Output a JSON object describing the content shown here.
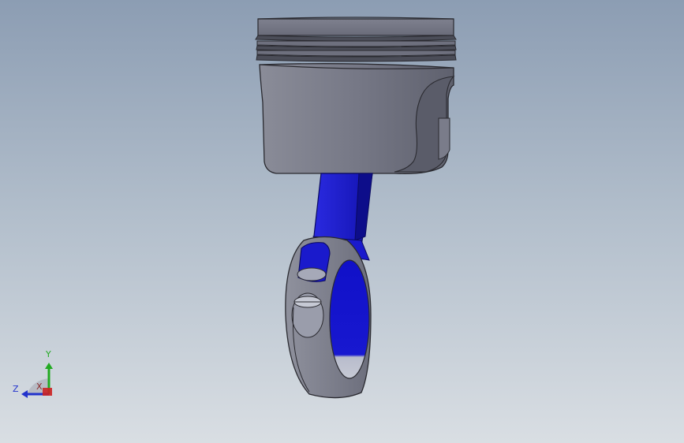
{
  "viewport": {
    "background_top": "#8c9db3",
    "background_bottom": "#d9dee3"
  },
  "model": {
    "piston_color": "#767886",
    "rod_color": "#1a1acc",
    "rod_dark_color": "#0d0d8a",
    "edge_color": "#2a2a30"
  },
  "triad": {
    "y_label": "Y",
    "z_label": "Z",
    "x_label": "X",
    "y_color": "#22aa22",
    "z_color": "#2233cc",
    "x_color": "#cc2222"
  }
}
